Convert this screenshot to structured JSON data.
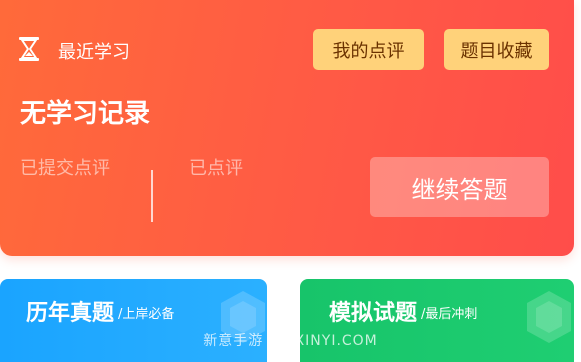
{
  "recent": {
    "label": "最近学习",
    "icon": "hourglass-icon"
  },
  "header_buttons": {
    "my_reviews": "我的点评",
    "favorites": "题目收藏"
  },
  "status": {
    "no_record": "无学习记录"
  },
  "stats": {
    "submitted_label": "已提交点评",
    "reviewed_label": "已点评"
  },
  "continue_label": "继续答题",
  "modes": [
    {
      "title": "历年真题",
      "subtitle": "/上岸必备",
      "color": "#1aa4ff"
    },
    {
      "title": "模拟试题",
      "subtitle": "/最后冲刺",
      "color": "#17c46a"
    }
  ],
  "watermark": "新意手游 · SIXINYI.COM",
  "colors": {
    "card_start": "#ff6a3a",
    "card_end": "#ff4d4a",
    "button_bg": "#ffd27a",
    "button_text": "#6b3200"
  }
}
